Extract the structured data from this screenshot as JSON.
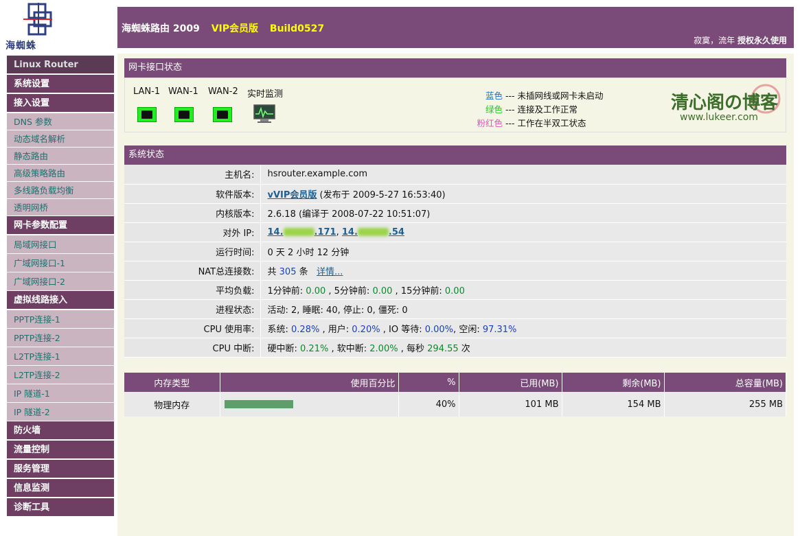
{
  "logo": {
    "text": "海蜘蛛"
  },
  "header": {
    "title": "海蜘蛛路由  2009",
    "edition": "VIP会员版",
    "build": "Build0527",
    "owner": "寂寞，流年",
    "license": "授权永久使用"
  },
  "sidebar": {
    "sections": [
      {
        "label": "Linux Router",
        "items": []
      },
      {
        "label": "系统设置",
        "items": []
      },
      {
        "label": "接入设置",
        "items": [
          "DNS 参数",
          "动态域名解析",
          "静态路由",
          "高级策略路由",
          "多线路负载均衡",
          "透明网桥"
        ]
      },
      {
        "label": "网卡参数配置",
        "items": [
          "局域网接口",
          "广域网接口-1",
          "广域网接口-2"
        ]
      },
      {
        "label": "虚拟线路接入",
        "items": [
          "PPTP连接-1",
          "PPTP连接-2",
          "L2TP连接-1",
          "L2TP连接-2",
          "IP 隧道-1",
          "IP 隧道-2"
        ]
      },
      {
        "label": "防火墙",
        "items": []
      },
      {
        "label": "流量控制",
        "items": []
      },
      {
        "label": "服务管理",
        "items": []
      },
      {
        "label": "信息监测",
        "items": []
      },
      {
        "label": "诊断工具",
        "items": []
      }
    ]
  },
  "nic": {
    "title": "网卡接口状态",
    "ports": [
      "LAN-1",
      "WAN-1",
      "WAN-2"
    ],
    "monitor_label": "实时监测",
    "legend": [
      {
        "color_name": "蓝色",
        "color": "#1a6fcf",
        "desc": "未插网线或网卡未启动"
      },
      {
        "color_name": "绿色",
        "color": "#22cc22",
        "desc": "连接及工作正常"
      },
      {
        "color_name": "粉红色",
        "color": "#e055c0",
        "desc": "工作在半双工状态"
      }
    ],
    "watermark": {
      "line1": "清心阁の博客",
      "line2": "www.lukeer.com"
    }
  },
  "system": {
    "title": "系统状态",
    "hostname_label": "主机名:",
    "hostname": "hsrouter.example.com",
    "software_label": "软件版本:",
    "software_link": "vVIP会员版",
    "software_release": "(发布于 2009-5-27 16:53:40)",
    "kernel_label": "内核版本:",
    "kernel": "2.6.18 (编译于 2008-07-22 10:51:07)",
    "ip_label": "对外 IP:",
    "ip1_prefix": "14.",
    "ip1_suffix": ".171",
    "ip2_prefix": "14.",
    "ip2_suffix": ".54",
    "uptime_label": "运行时间:",
    "uptime": "0 天 2 小时 12 分钟",
    "nat_label": "NAT总连接数:",
    "nat_prefix": "共",
    "nat_count": "305",
    "nat_unit": "条",
    "nat_detail": "详情...",
    "load_label": "平均负载:",
    "load_1_label": "1分钟前:",
    "load_1": "0.00",
    "load_5_label": "5分钟前:",
    "load_5": "0.00",
    "load_15_label": "15分钟前:",
    "load_15": "0.00",
    "proc_label": "进程状态:",
    "proc": "活动: 2, 睡眠: 40, 停止: 0, 僵死: 0",
    "cpu_label": "CPU 使用率:",
    "cpu_sys_label": "系统:",
    "cpu_sys": "0.28%",
    "cpu_user_label": "用户:",
    "cpu_user": "0.20%",
    "cpu_io_label": "IO 等待:",
    "cpu_io": "0.00%",
    "cpu_idle_label": "空闲:",
    "cpu_idle": "97.31%",
    "irq_label": "CPU 中断:",
    "irq_hard_label": "硬中断:",
    "irq_hard": "0.21%",
    "irq_soft_label": "软中断:",
    "irq_soft": "2.00%",
    "irq_rate_label": "每秒",
    "irq_rate": "294.55",
    "irq_rate_unit": "次"
  },
  "memory": {
    "headers": [
      "内存类型",
      "使用百分比",
      "%",
      "已用(MB)",
      "剩余(MB)",
      "总容量(MB)"
    ],
    "rows": [
      {
        "type": "物理内存",
        "usage_fraction": 0.4,
        "percent": "40%",
        "used": "101 MB",
        "free": "154 MB",
        "total": "255 MB"
      }
    ]
  }
}
